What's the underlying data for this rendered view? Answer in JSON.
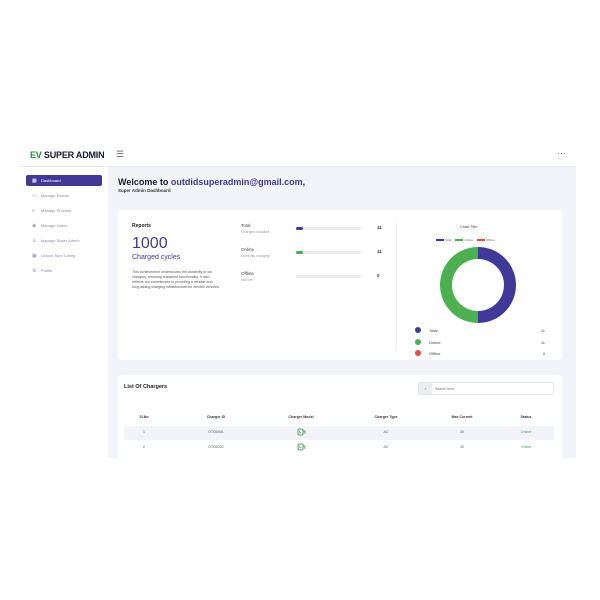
{
  "brand": {
    "ev": "EV",
    "name": "SUPER ADMIN"
  },
  "topbar": {
    "menu_icon": "hamburger-icon",
    "more_icon": "dots-icon"
  },
  "sidebar": {
    "items": [
      {
        "label": "Dashboard",
        "icon": "grid-icon",
        "active": true
      },
      {
        "label": "Manage Events",
        "icon": "calendar-icon"
      },
      {
        "label": "Manage Provider",
        "icon": "list-icon"
      },
      {
        "label": "Manage Users",
        "icon": "user-icon"
      },
      {
        "label": "Manage Super Admin",
        "icon": "person-icon"
      },
      {
        "label": "Output Type Config",
        "icon": "plug-icon"
      },
      {
        "label": "Profile",
        "icon": "gear-icon"
      }
    ]
  },
  "welcome": {
    "prefix": "Welcome to ",
    "email": "outdidsuperadmin@gmail.com",
    "suffix": ",",
    "subtitle": "Super Admin Dashboard"
  },
  "reports": {
    "title": "Reports",
    "big_number": "1000",
    "big_label": "Charged cycles",
    "description": "This achievement underscores the durability of our chargers, ensuring sustained functionality. It also reflects our commitment to providing a reliable and long-lasting charging infrastructure for electric vehicles.",
    "stats": [
      {
        "label": "Total",
        "sub": "Chargers installed",
        "value": "11",
        "fill": 0.1,
        "color": "#3f3a9a"
      },
      {
        "label": "Online",
        "sub": "Currently charging",
        "value": "11",
        "fill": 0.1,
        "color": "#4caf50"
      },
      {
        "label": "Offline",
        "sub": "Not live",
        "value": "0",
        "fill": 0,
        "color": "#e74c3c"
      }
    ]
  },
  "chart_data": {
    "type": "pie",
    "title": "Chart Title",
    "legend": [
      "Total",
      "Online",
      "Offline"
    ],
    "legend_position": "top",
    "categories": [
      "Total",
      "Online",
      "Offline"
    ],
    "values": [
      11,
      11,
      0
    ],
    "colors": [
      "#3f3a9a",
      "#4caf50",
      "#e74c3c"
    ]
  },
  "legend_list": [
    {
      "name": "Total",
      "value": "11",
      "color": "#3f3a9a"
    },
    {
      "name": "Online",
      "value": "11",
      "color": "#4caf50"
    },
    {
      "name": "Offline",
      "value": "0",
      "color": "#e74c3c"
    }
  ],
  "chargers": {
    "title": "List Of Chargers",
    "search_placeholder": "Search here",
    "columns": [
      "Sl.No",
      "Charger ID",
      "Charger Model",
      "Charger Type",
      "Max Current",
      "Status"
    ],
    "rows": [
      {
        "sl": "1",
        "id": "OTD0001",
        "model_icon": "charger-plug-icon",
        "type": "AC",
        "current": "30",
        "status": "Online"
      },
      {
        "sl": "2",
        "id": "OTD0002",
        "model_icon": "charger-plug-icon",
        "type": "AC",
        "current": "30",
        "status": "Online"
      }
    ]
  }
}
